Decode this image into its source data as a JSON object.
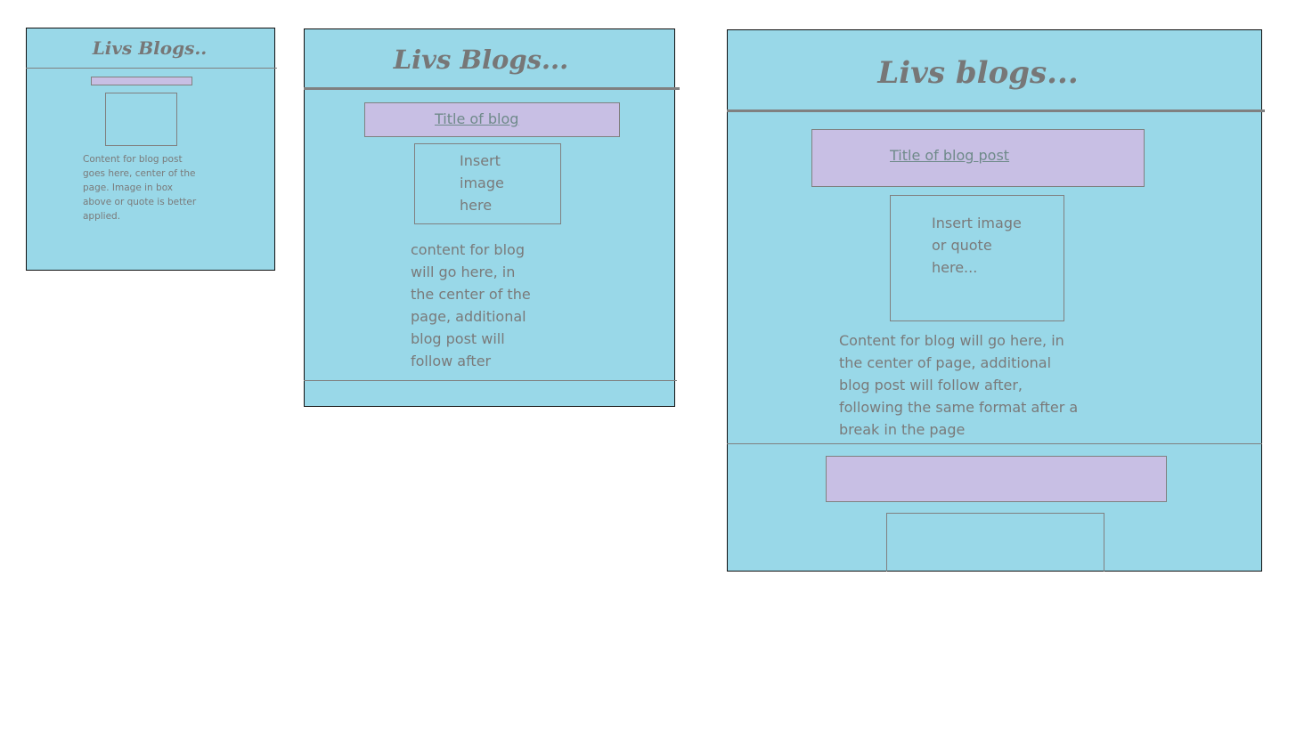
{
  "colors": {
    "background": "#99d8e8",
    "title_box": "#c8bfe4",
    "lines": "#808080"
  },
  "frames": [
    {
      "header": "Livs Blogs..",
      "title_box": "",
      "image_box": "",
      "content": "Content for blog post\ngoes here, center of the\npage. Image in box\nabove or quote is better\napplied."
    },
    {
      "header": "Livs Blogs...",
      "title_box": "Title of blog",
      "image_box": "Insert\nimage\nhere",
      "content": "content for blog\nwill go here, in\nthe center of the\npage, additional\nblog post will\nfollow after"
    },
    {
      "header": "Livs blogs...",
      "title_box": "Title of blog post",
      "image_box": "Insert image\nor quote\nhere...",
      "content": "Content for blog will go here, in\nthe center of page, additional\nblog post will follow after,\nfollowing the same format after a\nbreak in the page"
    }
  ]
}
